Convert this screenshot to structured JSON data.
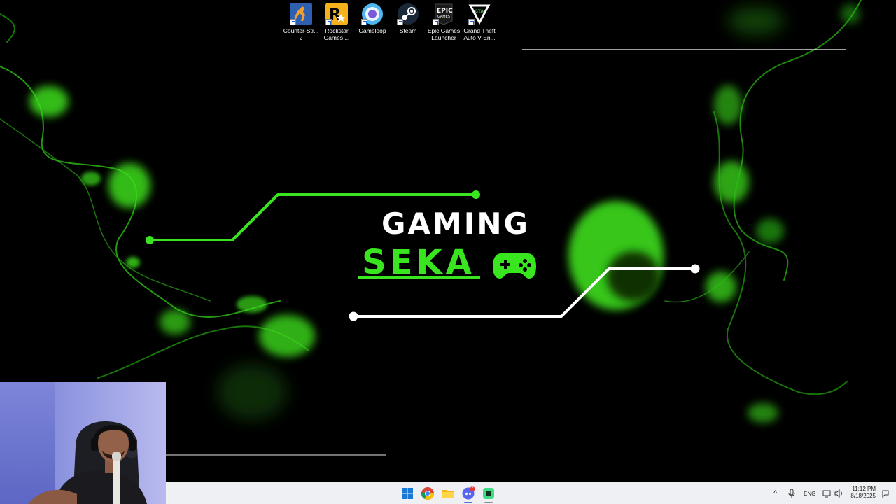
{
  "desktop": {
    "icons": [
      {
        "label": "Counter-Str... 2",
        "icon": "counter-strike-2-icon",
        "color": "#2f5fb0"
      },
      {
        "label": "Rockstar Games ...",
        "icon": "rockstar-games-icon",
        "color": "#f6b21a"
      },
      {
        "label": "Gameloop",
        "icon": "gameloop-icon",
        "color": "#3aa0e6"
      },
      {
        "label": "Steam",
        "icon": "steam-icon",
        "color": "#1b2838"
      },
      {
        "label": "Epic Games Launcher",
        "icon": "epic-games-icon",
        "color": "#1a1a1a"
      },
      {
        "label": "Grand Theft Auto V En...",
        "icon": "gta-v-icon",
        "color": "#2b2b2b"
      }
    ]
  },
  "wallpaper": {
    "title_line1": "GAMING",
    "title_line2": "SEKA",
    "accent_color": "#39e51e"
  },
  "taskbar": {
    "apps": [
      {
        "name": "start-button",
        "icon": "windows-icon"
      },
      {
        "name": "chrome",
        "icon": "chrome-icon"
      },
      {
        "name": "file-explorer",
        "icon": "folder-icon"
      },
      {
        "name": "discord",
        "icon": "discord-icon",
        "badge": "9"
      },
      {
        "name": "app-green",
        "icon": "green-app-icon"
      }
    ],
    "tray": {
      "language": "ENG",
      "time": "11:12 PM",
      "date": "8/18/2025"
    }
  }
}
